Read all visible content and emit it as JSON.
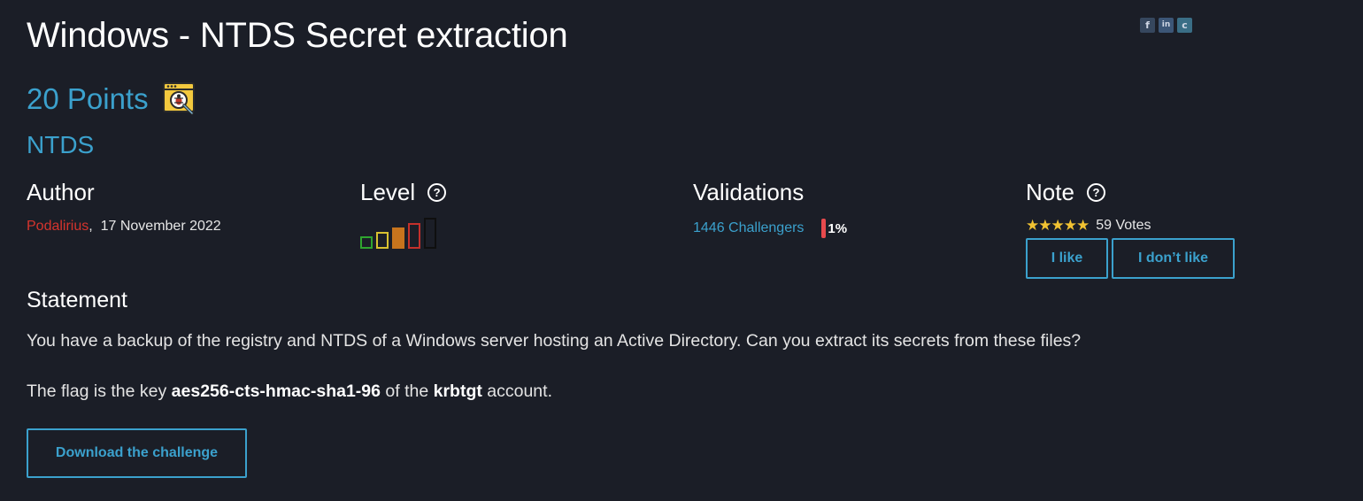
{
  "challenge": {
    "title": "Windows - NTDS Secret extraction",
    "points": "20 Points",
    "category_icon": "bug-in-window-icon",
    "category": "NTDS"
  },
  "social": [
    {
      "name": "facebook-icon",
      "glyph": "f"
    },
    {
      "name": "linkedin-icon",
      "glyph": "in"
    },
    {
      "name": "share-icon",
      "glyph": "c"
    }
  ],
  "author": {
    "heading": "Author",
    "name": "Podalirius",
    "separator": ",",
    "date": "17 November 2022"
  },
  "level": {
    "heading": "Level",
    "help": "?",
    "bars": [
      {
        "name": "level-bar-1",
        "color": "#2fa52f",
        "filled": false
      },
      {
        "name": "level-bar-2",
        "color": "#d9c130",
        "filled": false
      },
      {
        "name": "level-bar-3",
        "color": "#c7741d",
        "filled": true
      },
      {
        "name": "level-bar-4",
        "color": "#c4302b",
        "filled": false
      },
      {
        "name": "level-bar-5",
        "color": "#0f0f0f",
        "filled": false
      }
    ],
    "current_level": 3
  },
  "validations": {
    "heading": "Validations",
    "challengers": "1446 Challengers",
    "percent": "1%"
  },
  "note": {
    "heading": "Note",
    "help": "?",
    "stars": "★★★★★",
    "votes": "59 Votes",
    "like_label": "I like",
    "dislike_label": "I don’t like"
  },
  "statement": {
    "heading": "Statement",
    "paragraph1": "You have a backup of the registry and NTDS of a Windows server hosting an Active Directory. Can you extract its secrets from these files?",
    "p2_before": "The flag is the key ",
    "p2_key": "aes256-cts-hmac-sha1-96",
    "p2_middle": " of the ",
    "p2_account": "krbtgt",
    "p2_after": " account."
  },
  "download_label": "Download the challenge",
  "colors": {
    "background": "#1b1e27",
    "accent": "#3ba1cd",
    "author_link": "#d6342d",
    "star": "#f1c232",
    "validation_bar": "#e74a4d"
  }
}
